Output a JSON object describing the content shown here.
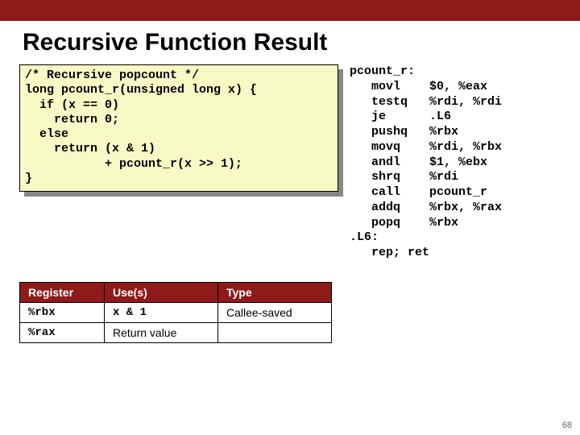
{
  "title": "Recursive Function Result",
  "code": {
    "l1": "/* Recursive popcount */",
    "l2": "long pcount_r(unsigned long x) {",
    "l3": "  if (x == 0)",
    "l4": "    return 0;",
    "l5": "  else",
    "l6": "    return (x & 1)",
    "l7": "           + pcount_r(x >> 1);",
    "l8": "}"
  },
  "asm": {
    "l1": "pcount_r:",
    "l2": "   movl    $0, %eax",
    "l3": "   testq   %rdi, %rdi",
    "l4": "   je      .L6",
    "l5": "   pushq   %rbx",
    "l6": "   movq    %rdi, %rbx",
    "l7": "   andl    $1, %ebx",
    "l8": "   shrq    %rdi",
    "l9": "   call    pcount_r",
    "l10": "   addq    %rbx, %rax",
    "l11": "   popq    %rbx",
    "l12": ".L6:",
    "l13": "   rep; ret"
  },
  "table": {
    "headers": {
      "c1": "Register",
      "c2": "Use(s)",
      "c3": "Type"
    },
    "rows": [
      {
        "reg": "%rbx",
        "use": "x & 1",
        "type": "Callee-saved"
      },
      {
        "reg": "%rax",
        "use": "Return value",
        "type": ""
      }
    ]
  },
  "page_number": "68"
}
